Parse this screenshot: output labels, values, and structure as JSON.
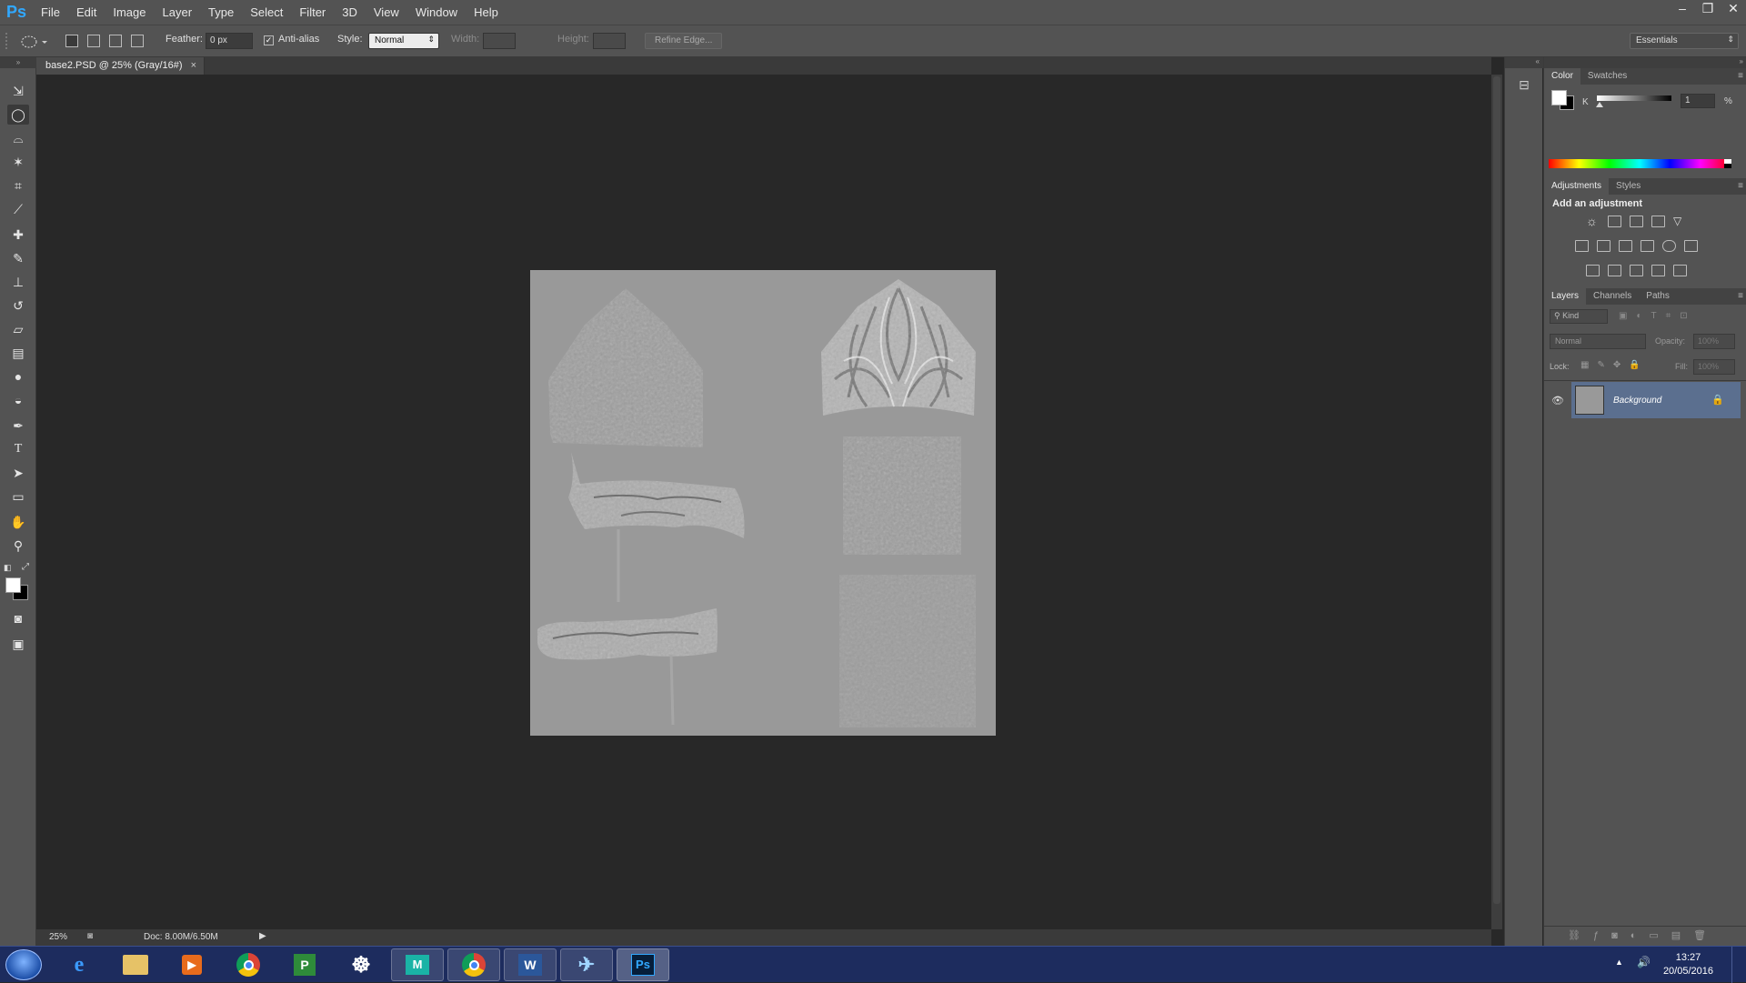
{
  "app": {
    "logo": "Ps",
    "menus": [
      "File",
      "Edit",
      "Image",
      "Layer",
      "Type",
      "Select",
      "Filter",
      "3D",
      "View",
      "Window",
      "Help"
    ],
    "window_controls": [
      "–",
      "❐",
      "✕"
    ]
  },
  "options": {
    "feather_label": "Feather:",
    "feather_value": "0 px",
    "antialias_label": "Anti-alias",
    "style_label": "Style:",
    "style_value": "Normal",
    "width_label": "Width:",
    "height_label": "Height:",
    "refine_edge_label": "Refine Edge...",
    "workspace": "Essentials"
  },
  "document": {
    "tab_title": "base2.PSD @ 25% (Gray/16#)",
    "close": "×",
    "canvas_gray": "#999999"
  },
  "status": {
    "zoom": "25%",
    "doc_size": "Doc: 8.00M/6.50M"
  },
  "color_panel": {
    "tabs": [
      "Color",
      "Swatches"
    ],
    "channel_label": "K",
    "channel_value": "1",
    "unit": "%"
  },
  "adjustments_panel": {
    "tabs": [
      "Adjustments",
      "Styles"
    ],
    "heading": "Add an adjustment"
  },
  "layers_panel": {
    "tabs": [
      "Layers",
      "Channels",
      "Paths"
    ],
    "filter_kind": "Kind",
    "blend_mode": "Normal",
    "opacity_label": "Opacity:",
    "opacity_value": "100%",
    "lock_label": "Lock:",
    "fill_label": "Fill:",
    "fill_value": "100%",
    "layers": [
      {
        "name": "Background",
        "visible": true,
        "locked": true
      }
    ]
  },
  "taskbar": {
    "time": "13:27",
    "date": "20/05/2016",
    "active_app": "Ps"
  },
  "colors": {
    "accent": "#31a8ff",
    "taskbar": "#1d2c5e",
    "ui_gray": "#535353"
  }
}
